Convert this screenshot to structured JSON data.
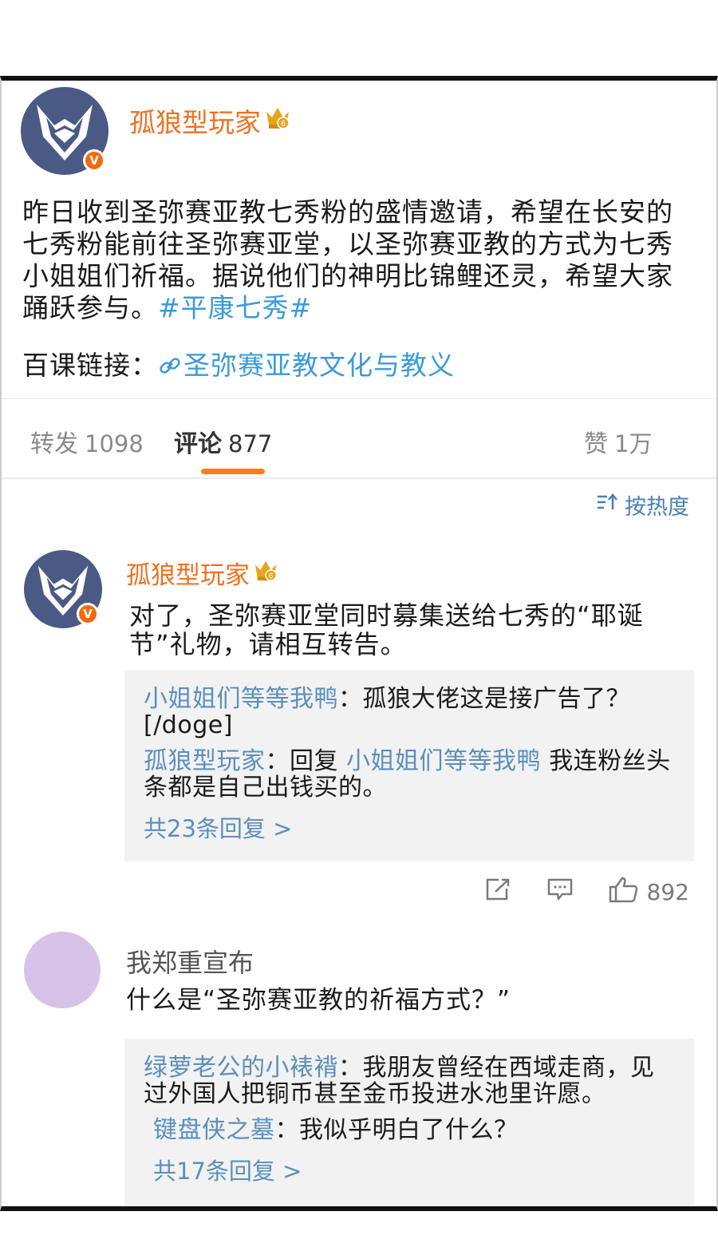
{
  "post": {
    "author": "孤狼型玩家",
    "badge": "V",
    "crown_level": "6",
    "body_text": "昨日收到圣弥赛亚教七秀粉的盛情邀请，希望在长安的七秀粉能前往圣弥赛亚堂，以圣弥赛亚教的方式为七秀小姐姐们祈福。据说他们的神明比锦鲤还灵，希望大家踊跃参与。",
    "topic": "#平康七秀#",
    "link_label": "百课链接：",
    "link_icon": "link-icon",
    "link_text": "圣弥赛亚教文化与教义"
  },
  "tabs": {
    "repost_label": "转发",
    "repost_count": "1098",
    "comment_label": "评论",
    "comment_count": "877",
    "like_label": "赞",
    "like_count": "1万"
  },
  "sort": {
    "label": "按热度",
    "icon": "sort-icon"
  },
  "comments": [
    {
      "author": "孤狼型玩家",
      "badge": "V",
      "text": "对了，圣弥赛亚堂同时募集送给七秀的“耶诞节”礼物，请相互转告。",
      "replies": [
        {
          "who": "小姐姐们等等我鸭",
          "sep": "：",
          "text": "孤狼大佬这是接广告了？[/doge]"
        },
        {
          "who": "孤狼型玩家",
          "sep": "：",
          "pre": "回复 ",
          "to": "小姐姐们等等我鸭",
          "text": " 我连粉丝头条都是自己出钱买的。"
        }
      ],
      "more": "共23条回复 >",
      "like_count": "892"
    },
    {
      "author": "我郑重宣布",
      "avatar_color": "#d7c3e9",
      "text": "什么是“圣弥赛亚教的祈福方式？”",
      "replies": [
        {
          "who": "绿萝老公的小裱褙",
          "sep": "：",
          "text": "我朋友曾经在西域走商，见过外国人把铜币甚至金币投进水池里许愿。"
        },
        {
          "who": "键盘侠之墓",
          "sep": "：",
          "text": "我似乎明白了什么？"
        }
      ],
      "more": "共17条回复 >"
    }
  ],
  "colors": {
    "username": "#f07020",
    "link": "#3a9ad9",
    "reply_name": "#5b8fbd",
    "tab_underline": "#ff7c1c"
  }
}
